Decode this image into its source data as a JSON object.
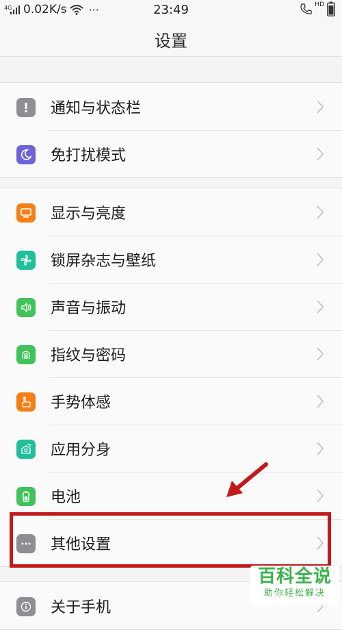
{
  "status_bar": {
    "signal_text": "4G",
    "speed": "0.02K/s",
    "time": "23:49",
    "hd_badge": "HD",
    "more_dots": "···"
  },
  "header": {
    "title": "设置"
  },
  "groups": [
    {
      "items": [
        {
          "label": "通知与状态栏",
          "icon": "exclamation-icon",
          "color": "#8e8e93"
        },
        {
          "label": "免打扰模式",
          "icon": "moon-icon",
          "color": "#6e63d8"
        }
      ]
    },
    {
      "items": [
        {
          "label": "显示与亮度",
          "icon": "monitor-icon",
          "color": "#f57f17"
        },
        {
          "label": "锁屏杂志与壁纸",
          "icon": "pinwheel-icon",
          "color": "#1fbf9a"
        },
        {
          "label": "声音与振动",
          "icon": "speaker-icon",
          "color": "#3fc35a"
        },
        {
          "label": "指纹与密码",
          "icon": "fingerprint-icon",
          "color": "#3fc35a"
        },
        {
          "label": "手势体感",
          "icon": "hand-icon",
          "color": "#f57f17"
        },
        {
          "label": "应用分身",
          "icon": "clone-icon",
          "color": "#1fbf9a"
        },
        {
          "label": "电池",
          "icon": "battery-icon",
          "color": "#3fc35a"
        },
        {
          "label": "其他设置",
          "icon": "more-dots-icon",
          "color": "#8e8e93"
        }
      ]
    },
    {
      "items": [
        {
          "label": "关于手机",
          "icon": "info-icon",
          "color": "#8e8e93"
        }
      ]
    }
  ],
  "watermark": {
    "main": "百科全说",
    "sub": "助你轻松解决"
  },
  "annotation": {
    "highlight_color": "#c21a1a"
  }
}
